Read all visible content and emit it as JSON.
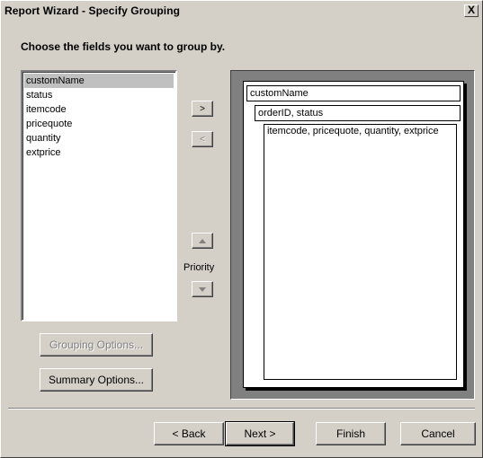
{
  "window": {
    "title": "Report Wizard - Specify Grouping",
    "close_glyph": "X"
  },
  "instruction": "Choose the fields you want to group by.",
  "fields": [
    {
      "label": "customName",
      "selected": true
    },
    {
      "label": "status",
      "selected": false
    },
    {
      "label": "itemcode",
      "selected": false
    },
    {
      "label": "pricequote",
      "selected": false
    },
    {
      "label": "quantity",
      "selected": false
    },
    {
      "label": "extprice",
      "selected": false
    }
  ],
  "move_buttons": {
    "add_label": ">",
    "remove_label": "<"
  },
  "priority": {
    "label": "Priority",
    "up_icon": "arrow-up-icon",
    "down_icon": "arrow-down-icon"
  },
  "groups": {
    "level1": "customName",
    "level2": "orderID, status",
    "level3": "itemcode, pricequote, quantity, extprice"
  },
  "options_buttons": {
    "grouping_label": "Grouping Options...",
    "summary_label": "Summary Options..."
  },
  "footer": {
    "back_label": "< Back",
    "next_label": "Next >",
    "finish_label": "Finish",
    "cancel_label": "Cancel"
  }
}
